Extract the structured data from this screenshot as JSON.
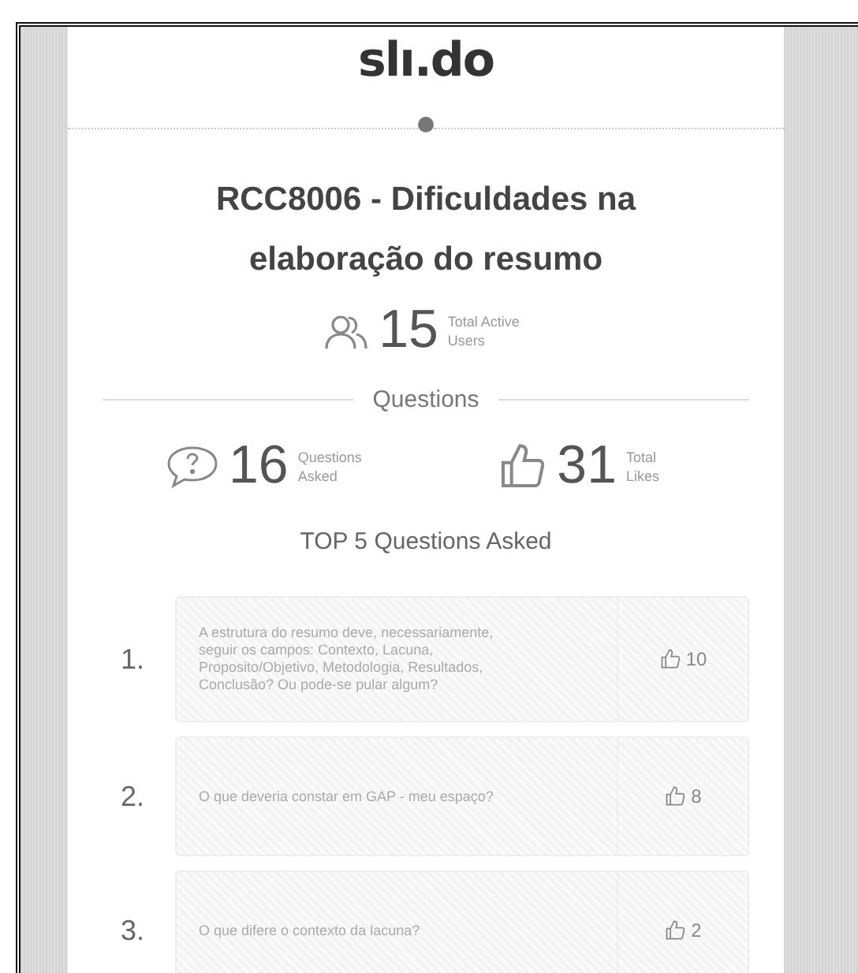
{
  "logo": "slı.do",
  "event_title": "RCC8006 - Dificuldades na elaboração do resumo",
  "active_users": {
    "count": "15",
    "label": "Total Active Users"
  },
  "section_title": "Questions",
  "stats": [
    {
      "kind": "questions",
      "count": "16",
      "label": "Questions Asked"
    },
    {
      "kind": "likes",
      "count": "31",
      "label": "Total Likes"
    }
  ],
  "top_title": "TOP 5 Questions Asked",
  "questions": [
    {
      "rank": "1.",
      "text": "A estrutura do resumo deve, necessariamente, seguir os campos: Contexto, Lacuna, Proposito/Objetivo, Metodologia, Resultados, Conclusão? Ou pode-se pular algum?",
      "likes": "10"
    },
    {
      "rank": "2.",
      "text": "O que deveria constar em GAP - meu espaço?",
      "likes": "8"
    },
    {
      "rank": "3.",
      "text": "O que difere o contexto da lacuna?",
      "likes": "2"
    }
  ]
}
